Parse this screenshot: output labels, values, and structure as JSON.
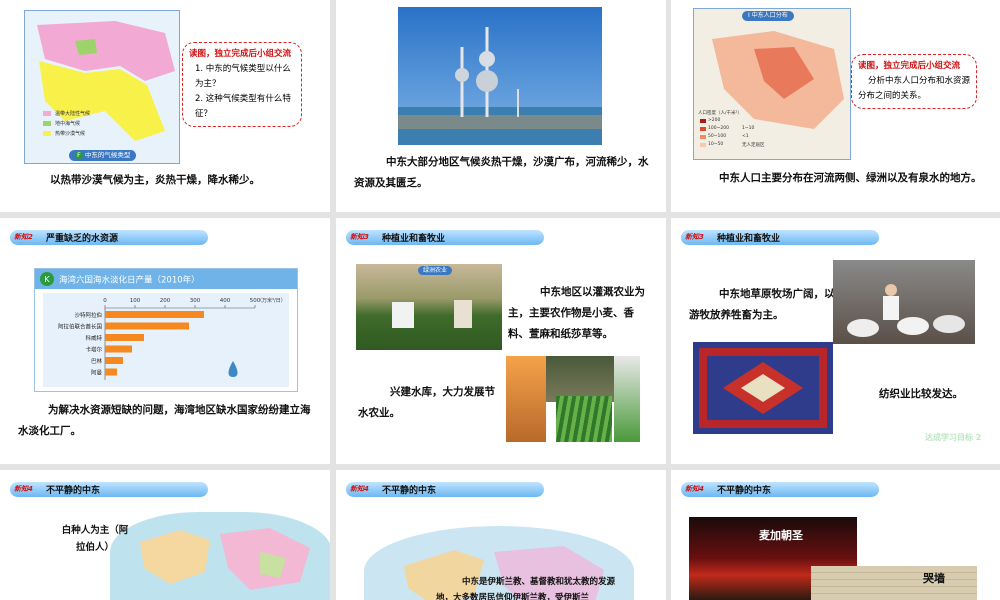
{
  "slides": {
    "s1": {
      "map_title": "中东的气候类型",
      "map_letter": "F",
      "legend": [
        "温带大陆性气候",
        "地中海气候",
        "热带沙漠气候"
      ],
      "bubble_head": "读图，独立完成后小组交流",
      "bubble_q1": "1. 中东的气候类型以什么为主？",
      "bubble_q2": "2. 这种气候类型有什么特征？",
      "body": "以热带沙漠气候为主，炎热干燥，降水稀少。"
    },
    "s2": {
      "body": "中东大部分地区气候炎热干燥，沙漠广布，河流稀少，水资源及其匮乏。"
    },
    "s3": {
      "map_title": "中东人口分布",
      "map_letter": "I",
      "legend_title": "人口密度（人/千米²）",
      "legend": [
        ">200",
        "100~200",
        "50~100",
        "10~50",
        "1~10",
        "<1",
        "无人定居区"
      ],
      "bubble_head": "读图，独立完成后小组交流",
      "bubble_text": "分析中东人口分布和水资源分布之间的关系。",
      "body": "中东人口主要分布在河流两侧、绿洲以及有泉水的地方。"
    },
    "s4": {
      "tag": "新知2",
      "title": "严重缺乏的水资源",
      "chart_letter": "K",
      "body": "为解决水资源短缺的问题，海湾地区缺水国家纷纷建立海水淡化工厂。"
    },
    "s5": {
      "tag": "新知3",
      "title": "种植业和畜牧业",
      "photo_label": "绿洲农业",
      "text1": "中东地区以灌溉农业为主，主要农作物是小麦、香料、萱麻和纸莎草等。",
      "text2": "兴建水库，大力发展节水农业。"
    },
    "s6": {
      "tag": "新知3",
      "title": "种植业和畜牧业",
      "text1": "中东地草原牧场广阔，以游牧放养牲畜为主。",
      "text2": "纺织业比较发达。",
      "link": "达成学习目标 2"
    },
    "s7": {
      "tag": "新知4",
      "title": "不平静的中东",
      "text": "白种人为主（阿拉伯人）"
    },
    "s8": {
      "tag": "新知4",
      "title": "不平静的中东",
      "text": "中东是伊斯兰教、基督教和犹太教的发源地，大多数居民信仰伊斯兰教，受伊斯兰"
    },
    "s9": {
      "tag": "新知4",
      "title": "不平静的中东",
      "label1": "麦加朝圣",
      "label2": "哭墙"
    }
  },
  "chart_data": {
    "type": "bar",
    "title": "海湾六国海水淡化日产量（2010年）",
    "unit": "（万米³/日）",
    "categories": [
      "沙特阿拉伯",
      "阿拉伯联合酋长国",
      "科威特",
      "卡塔尔",
      "巴林",
      "阿曼"
    ],
    "values": [
      330,
      280,
      130,
      90,
      60,
      40
    ],
    "xticks": [
      0,
      100,
      200,
      300,
      400,
      500
    ],
    "xlim": [
      0,
      500
    ],
    "bar_color": "#f5891f"
  }
}
